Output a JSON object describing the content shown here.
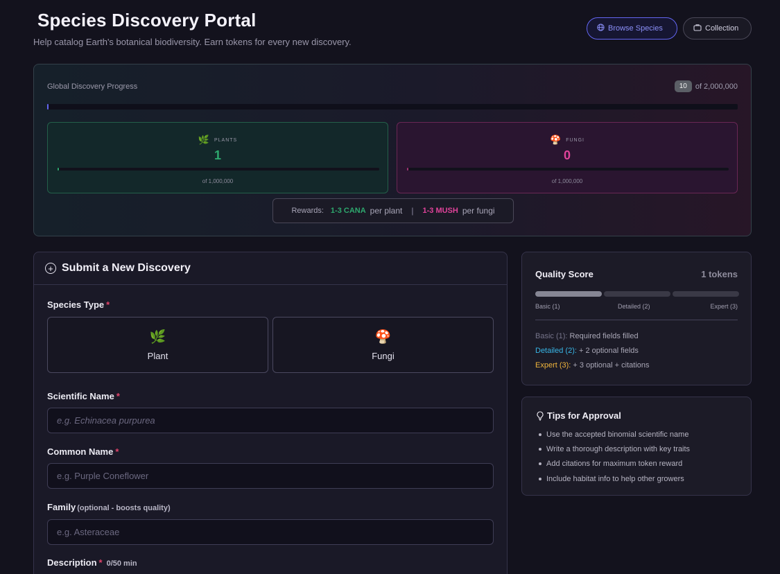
{
  "header": {
    "title": "Species Discovery Portal",
    "subtitle": "Help catalog Earth's botanical biodiversity. Earn tokens for every new discovery.",
    "browse_label": "Browse Species",
    "collection_label": "Collection"
  },
  "progress": {
    "label": "Global Discovery Progress",
    "count": "10",
    "of_total": "of 2,000,000",
    "fraction": 5e-06,
    "plants": {
      "label": "PLANTS",
      "value": "1",
      "of": "of 1,000,000",
      "fraction": 1e-06,
      "icon": "seedling-icon"
    },
    "fungi": {
      "label": "FUNGI",
      "value": "0",
      "of": "of 1,000,000",
      "fraction": 0.0,
      "icon": "mushroom-icon"
    },
    "rewards": {
      "label": "Rewards:",
      "plant_amount": "1-3 CANA",
      "plant_suffix": "per plant",
      "separator": "|",
      "fungi_amount": "1-3 MUSH",
      "fungi_suffix": "per fungi"
    }
  },
  "form": {
    "title": "Submit a New Discovery",
    "species_type": {
      "label": "Species Type",
      "required": "*",
      "options": [
        "Plant",
        "Fungi"
      ]
    },
    "scientific_name": {
      "label": "Scientific Name",
      "required": "*",
      "placeholder": "e.g. Echinacea purpurea",
      "value": ""
    },
    "common_name": {
      "label": "Common Name",
      "required": "*",
      "placeholder": "e.g. Purple Coneflower",
      "value": ""
    },
    "family": {
      "label": "Family",
      "note": "(optional - boosts quality)",
      "placeholder": "e.g. Asteraceae",
      "value": ""
    },
    "description": {
      "label": "Description",
      "required": "*",
      "min_note": "0/50 min"
    }
  },
  "quality": {
    "title": "Quality Score",
    "tokens": "1 tokens",
    "level": 1,
    "levels": [
      "Basic (1)",
      "Detailed (2)",
      "Expert (3)"
    ],
    "descriptions": [
      {
        "key": "Basic (1):",
        "text": "Required fields filled"
      },
      {
        "key": "Detailed (2):",
        "text": "+ 2 optional fields"
      },
      {
        "key": "Expert (3):",
        "text": "+ 3 optional + citations"
      }
    ]
  },
  "tips": {
    "title": "Tips for Approval",
    "items": [
      "Use the accepted binomial scientific name",
      "Write a thorough description with key traits",
      "Add citations for maximum token reward",
      "Include habitat info to help other growers"
    ]
  },
  "colors": {
    "accent": "#6366f1",
    "plants": "#2ea86e",
    "fungi": "#e0439a",
    "required": "#e0436a",
    "detailed": "#38b6e6",
    "expert": "#f0b53c"
  }
}
